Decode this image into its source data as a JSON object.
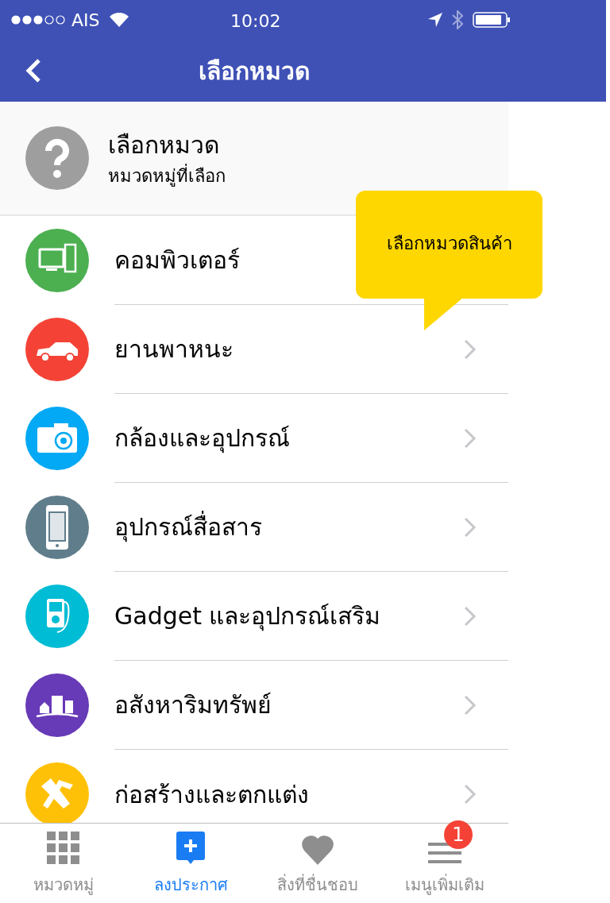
{
  "status_bar": {
    "carrier": "AIS",
    "time": "10:02"
  },
  "header": {
    "title": "เลือกหมวด"
  },
  "current": {
    "title": "เลือกหมวด",
    "subtitle": "หมวดหมู่ที่เลือก"
  },
  "tooltip": {
    "text": "เลือกหมวดสินค้า"
  },
  "categories": [
    {
      "label": "คอมพิวเตอร์",
      "kind": "computer",
      "color": "#4caf50"
    },
    {
      "label": "ยานพาหนะ",
      "kind": "car",
      "color": "#f44336"
    },
    {
      "label": "กล้องและอุปกรณ์",
      "kind": "camera",
      "color": "#03a9f4"
    },
    {
      "label": "อุปกรณ์สื่อสาร",
      "kind": "phone",
      "color": "#607d8b"
    },
    {
      "label": "Gadget และอุปกรณ์เสริม",
      "kind": "player",
      "color": "#00bcd4"
    },
    {
      "label": "อสังหาริมทรัพย์",
      "kind": "buildings",
      "color": "#673ab7"
    },
    {
      "label": "ก่อสร้างและตกแต่ง",
      "kind": "tools",
      "color": "#ffc107"
    }
  ],
  "tabs": [
    {
      "label": "หมวดหมู่",
      "kind": "grid",
      "selected": false
    },
    {
      "label": "ลงประกาศ",
      "kind": "post",
      "selected": true
    },
    {
      "label": "สิ่งที่ชื่นชอบ",
      "kind": "heart",
      "selected": false
    },
    {
      "label": "เมนูเพิ่มเติม",
      "kind": "menu",
      "selected": false,
      "badge": "1"
    }
  ]
}
